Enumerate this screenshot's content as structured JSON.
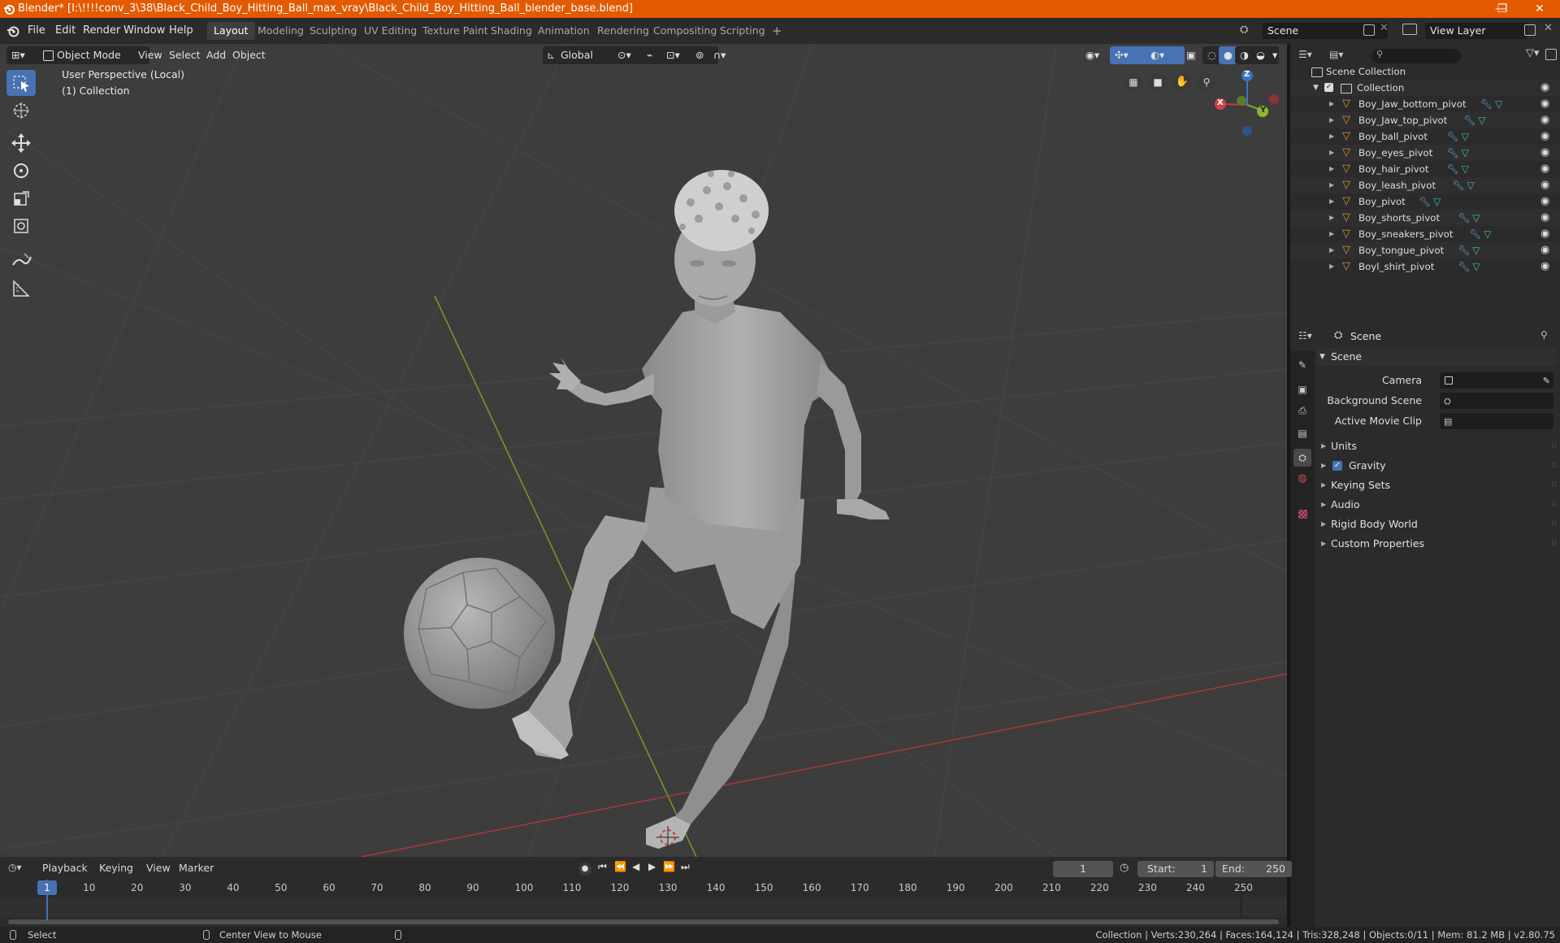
{
  "titlebar": {
    "title": "Blender* [I:\\!!!!conv_3\\38\\Black_Child_Boy_Hitting_Ball_max_vray\\Black_Child_Boy_Hitting_Ball_blender_base.blend]",
    "minimize": "—",
    "maximize": "❐",
    "close": "✕",
    "bg_color": "#e35a00"
  },
  "menu": {
    "items": [
      "File",
      "Edit",
      "Render",
      "Window",
      "Help"
    ]
  },
  "workspaces": {
    "tabs": [
      "Layout",
      "Modeling",
      "Sculpting",
      "UV Editing",
      "Texture Paint",
      "Shading",
      "Animation",
      "Rendering",
      "Compositing",
      "Scripting"
    ],
    "active": "Layout",
    "add": "+"
  },
  "scene_selector": {
    "value": "Scene"
  },
  "view_layer_selector": {
    "value": "View Layer"
  },
  "viewport_header": {
    "mode": "Object Mode",
    "menus": [
      "View",
      "Select",
      "Add",
      "Object"
    ],
    "orientation": "Global"
  },
  "viewport": {
    "perspective_label": "User Perspective (Local)",
    "collection_label": "(1) Collection",
    "gizmo": {
      "x": "X",
      "y": "Y",
      "z": "Z"
    },
    "bg_color": "#3d3d3d",
    "accent_color": "#4772b3"
  },
  "outliner": {
    "search_placeholder": "",
    "root": "Scene Collection",
    "collection": "Collection",
    "objects": [
      "Boy_Jaw_bottom_pivot",
      "Boy_Jaw_top_pivot",
      "Boy_ball_pivot",
      "Boy_eyes_pivot",
      "Boy_hair_pivot",
      "Boy_leash_pivot",
      "Boy_pivot",
      "Boy_shorts_pivot",
      "Boy_sneakers_pivot",
      "Boy_tongue_pivot",
      "Boyl_shirt_pivot"
    ]
  },
  "properties": {
    "context": "Scene",
    "panel_title": "Scene",
    "fields": [
      {
        "label": "Camera",
        "value": ""
      },
      {
        "label": "Background Scene",
        "value": ""
      },
      {
        "label": "Active Movie Clip",
        "value": ""
      }
    ],
    "panels": [
      "Units",
      "Gravity",
      "Keying Sets",
      "Audio",
      "Rigid Body World",
      "Custom Properties"
    ],
    "gravity_checked": true
  },
  "timeline": {
    "menus": [
      "Playback",
      "Keying",
      "View",
      "Marker"
    ],
    "current_frame": "1",
    "start_label": "Start:",
    "start": "1",
    "end_label": "End:",
    "end": "250",
    "ticks": [
      "1",
      "10",
      "20",
      "30",
      "40",
      "50",
      "60",
      "70",
      "80",
      "90",
      "100",
      "110",
      "120",
      "130",
      "140",
      "150",
      "160",
      "170",
      "180",
      "190",
      "200",
      "210",
      "220",
      "230",
      "240",
      "250"
    ]
  },
  "statusbar": {
    "left_action": "Select",
    "mid_action": "Center View to Mouse",
    "stats": "Collection | Verts:230,264 | Faces:164,124 | Tris:328,248 | Objects:0/11 | Mem: 81.2 MB | v2.80.75"
  }
}
